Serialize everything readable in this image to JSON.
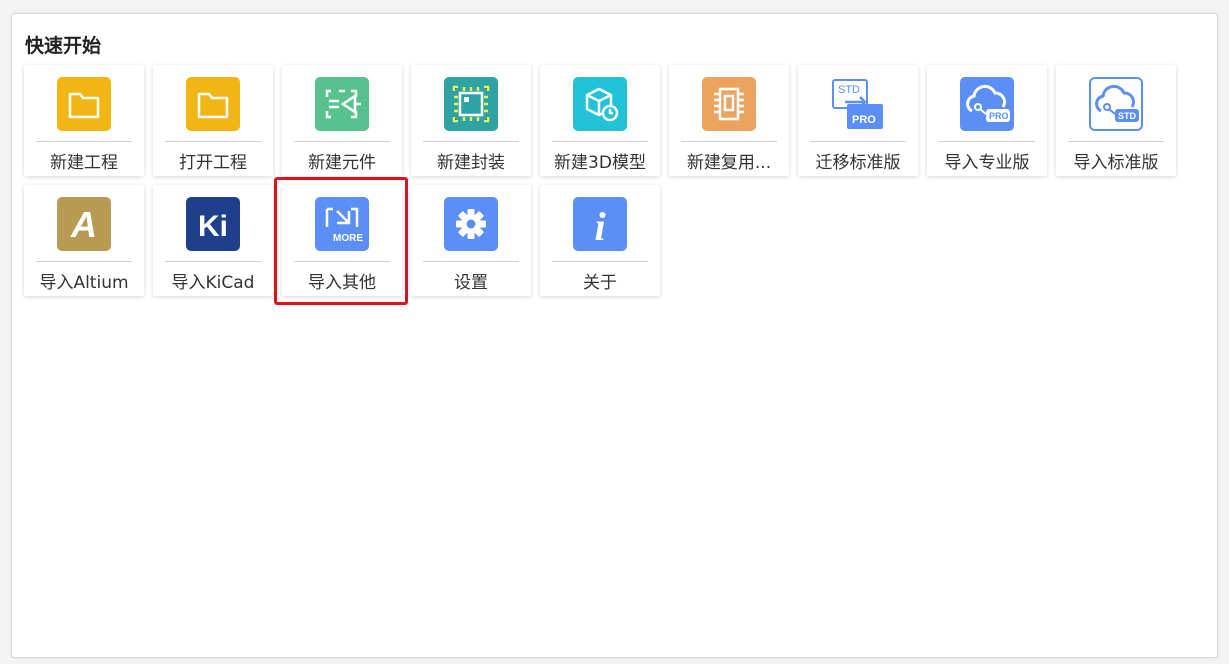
{
  "panel": {
    "title": "快速开始"
  },
  "row1": [
    {
      "label": "新建工程",
      "icon": "folder-icon"
    },
    {
      "label": "打开工程",
      "icon": "folder-open-icon"
    },
    {
      "label": "新建元件",
      "icon": "schematic-symbol-icon"
    },
    {
      "label": "新建封装",
      "icon": "footprint-chip-icon"
    },
    {
      "label": "新建3D模型",
      "icon": "3d-box-icon"
    },
    {
      "label": "新建复用...",
      "icon": "reuse-chip-icon"
    },
    {
      "label": "迁移标准版",
      "icon": "std-to-pro-icon"
    },
    {
      "label": "导入专业版",
      "icon": "cloud-pro-icon"
    },
    {
      "label": "导入标准版",
      "icon": "cloud-std-icon"
    }
  ],
  "row2": [
    {
      "label": "导入Altium",
      "icon": "altium-icon",
      "glyph": "A"
    },
    {
      "label": "导入KiCad",
      "icon": "kicad-icon",
      "glyph": "Ki"
    },
    {
      "label": "导入其他",
      "icon": "import-more-icon",
      "glyph": "MORE"
    },
    {
      "label": "设置",
      "icon": "gear-icon"
    },
    {
      "label": "关于",
      "icon": "info-icon",
      "glyph": "i"
    }
  ],
  "icon_badges": {
    "std": "STD",
    "pro": "PRO"
  },
  "colors": {
    "folder": "#f2b516",
    "green": "#58c28f",
    "teal": "#2fa2a4",
    "cyan": "#22c3d9",
    "orange": "#eca35f",
    "blue": "#5b8ff5",
    "gold": "#b89a52",
    "navy": "#1e3f8c",
    "highlight": "#e0121b"
  }
}
